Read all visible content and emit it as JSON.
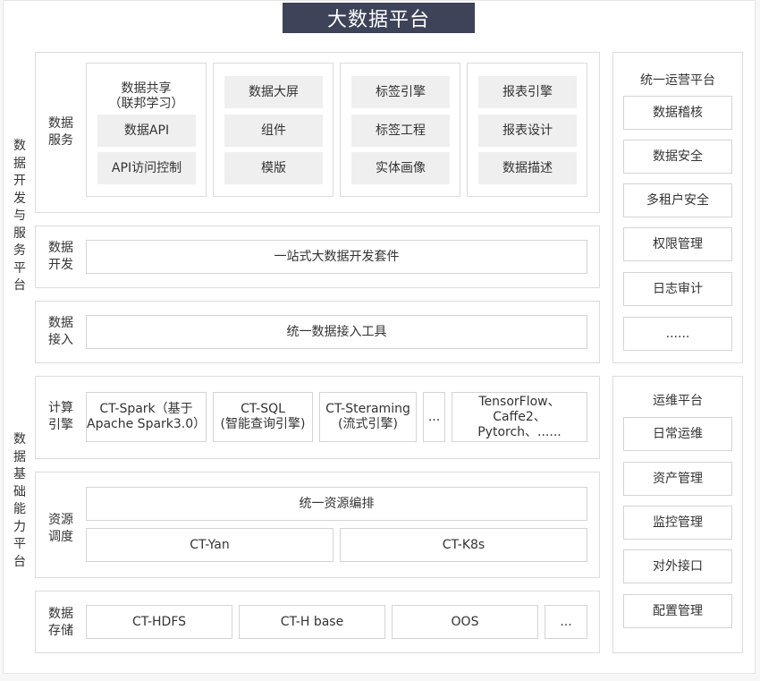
{
  "title": "大数据平台",
  "left_groups": {
    "upper": "数据开发与服务平台",
    "lower": "数据基础能力平台"
  },
  "rows": {
    "service": {
      "label": "数据\n服务",
      "col1": {
        "header": "数据共享\n（联邦学习）",
        "items": [
          "数据API",
          "API访问控制"
        ]
      },
      "col2": [
        "数据大屏",
        "组件",
        "模版"
      ],
      "col3": [
        "标签引擎",
        "标签工程",
        "实体画像"
      ],
      "col4": [
        "报表引擎",
        "报表设计",
        "数据描述"
      ]
    },
    "dev": {
      "label": "数据\n开发",
      "content": "一站式大数据开发套件"
    },
    "ingest": {
      "label": "数据\n接入",
      "content": "统一数据接入工具"
    },
    "compute": {
      "label": "计算\n引擎",
      "items": [
        "CT-Spark（基于\nApache Spark3.0）",
        "CT-SQL\n(智能查询引擎)",
        "CT-Steraming\n(流式引擎)",
        "...",
        "TensorFlow、Caffe2、\nPytorch、......"
      ]
    },
    "resource": {
      "label": "资源\n调度",
      "top": "统一资源编排",
      "items": [
        "CT-Yan",
        "CT-K8s"
      ]
    },
    "storage": {
      "label": "数据\n存储",
      "items": [
        "CT-HDFS",
        "CT-H base",
        "OOS",
        "..."
      ]
    }
  },
  "ops_platform": {
    "title": "统一运营平台",
    "items": [
      "数据稽核",
      "数据安全",
      "多租户安全",
      "权限管理",
      "日志审计",
      "......"
    ]
  },
  "maint_platform": {
    "title": "运维平台",
    "items": [
      "日常运维",
      "资产管理",
      "监控管理",
      "对外接口",
      "配置管理"
    ]
  }
}
